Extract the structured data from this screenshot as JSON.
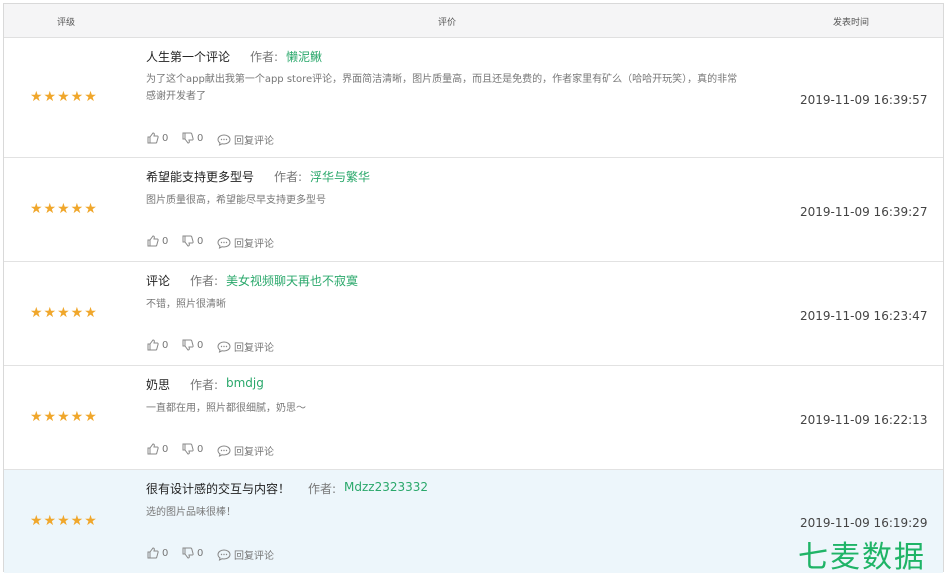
{
  "header": {
    "rating": "评级",
    "review": "评价",
    "time": "发表时间"
  },
  "stars": "★★★★★",
  "author_label": "作者:",
  "reviews": [
    {
      "title": "人生第一个评论",
      "author": "懒泥鳅",
      "content": "为了这个app献出我第一个app store评论，界面简洁清晰，图片质量高，而且还是免费的，作者家里有矿么（哈哈开玩笑），真的非常感谢开发者了",
      "likes": "0",
      "dislikes": "0",
      "reply": "回复评论",
      "time": "2019-11-09 16:39:57"
    },
    {
      "title": "希望能支持更多型号",
      "author": "浮华与繁华",
      "content": "图片质量很高，希望能尽早支持更多型号",
      "likes": "0",
      "dislikes": "0",
      "reply": "回复评论",
      "time": "2019-11-09 16:39:27"
    },
    {
      "title": "评论",
      "author": "美女视频聊天再也不寂寞",
      "content": "不错，照片很清晰",
      "likes": "0",
      "dislikes": "0",
      "reply": "回复评论",
      "time": "2019-11-09 16:23:47"
    },
    {
      "title": "奶思",
      "author": "bmdjg",
      "content": "一直都在用，照片都很细腻，奶思～",
      "likes": "0",
      "dislikes": "0",
      "reply": "回复评论",
      "time": "2019-11-09 16:22:13"
    },
    {
      "title": "很有设计感的交互与内容！",
      "author": "Mdzz2323332",
      "content": "选的图片品味很棒！",
      "likes": "0",
      "dislikes": "0",
      "reply": "回复评论",
      "time": "2019-11-09 16:19:29"
    }
  ],
  "watermark": "七麦数据",
  "colors": {
    "star": "#f0a72c",
    "author": "#2aa86b",
    "highlight_row": "#edf6fb",
    "watermark": "#1fb467"
  }
}
